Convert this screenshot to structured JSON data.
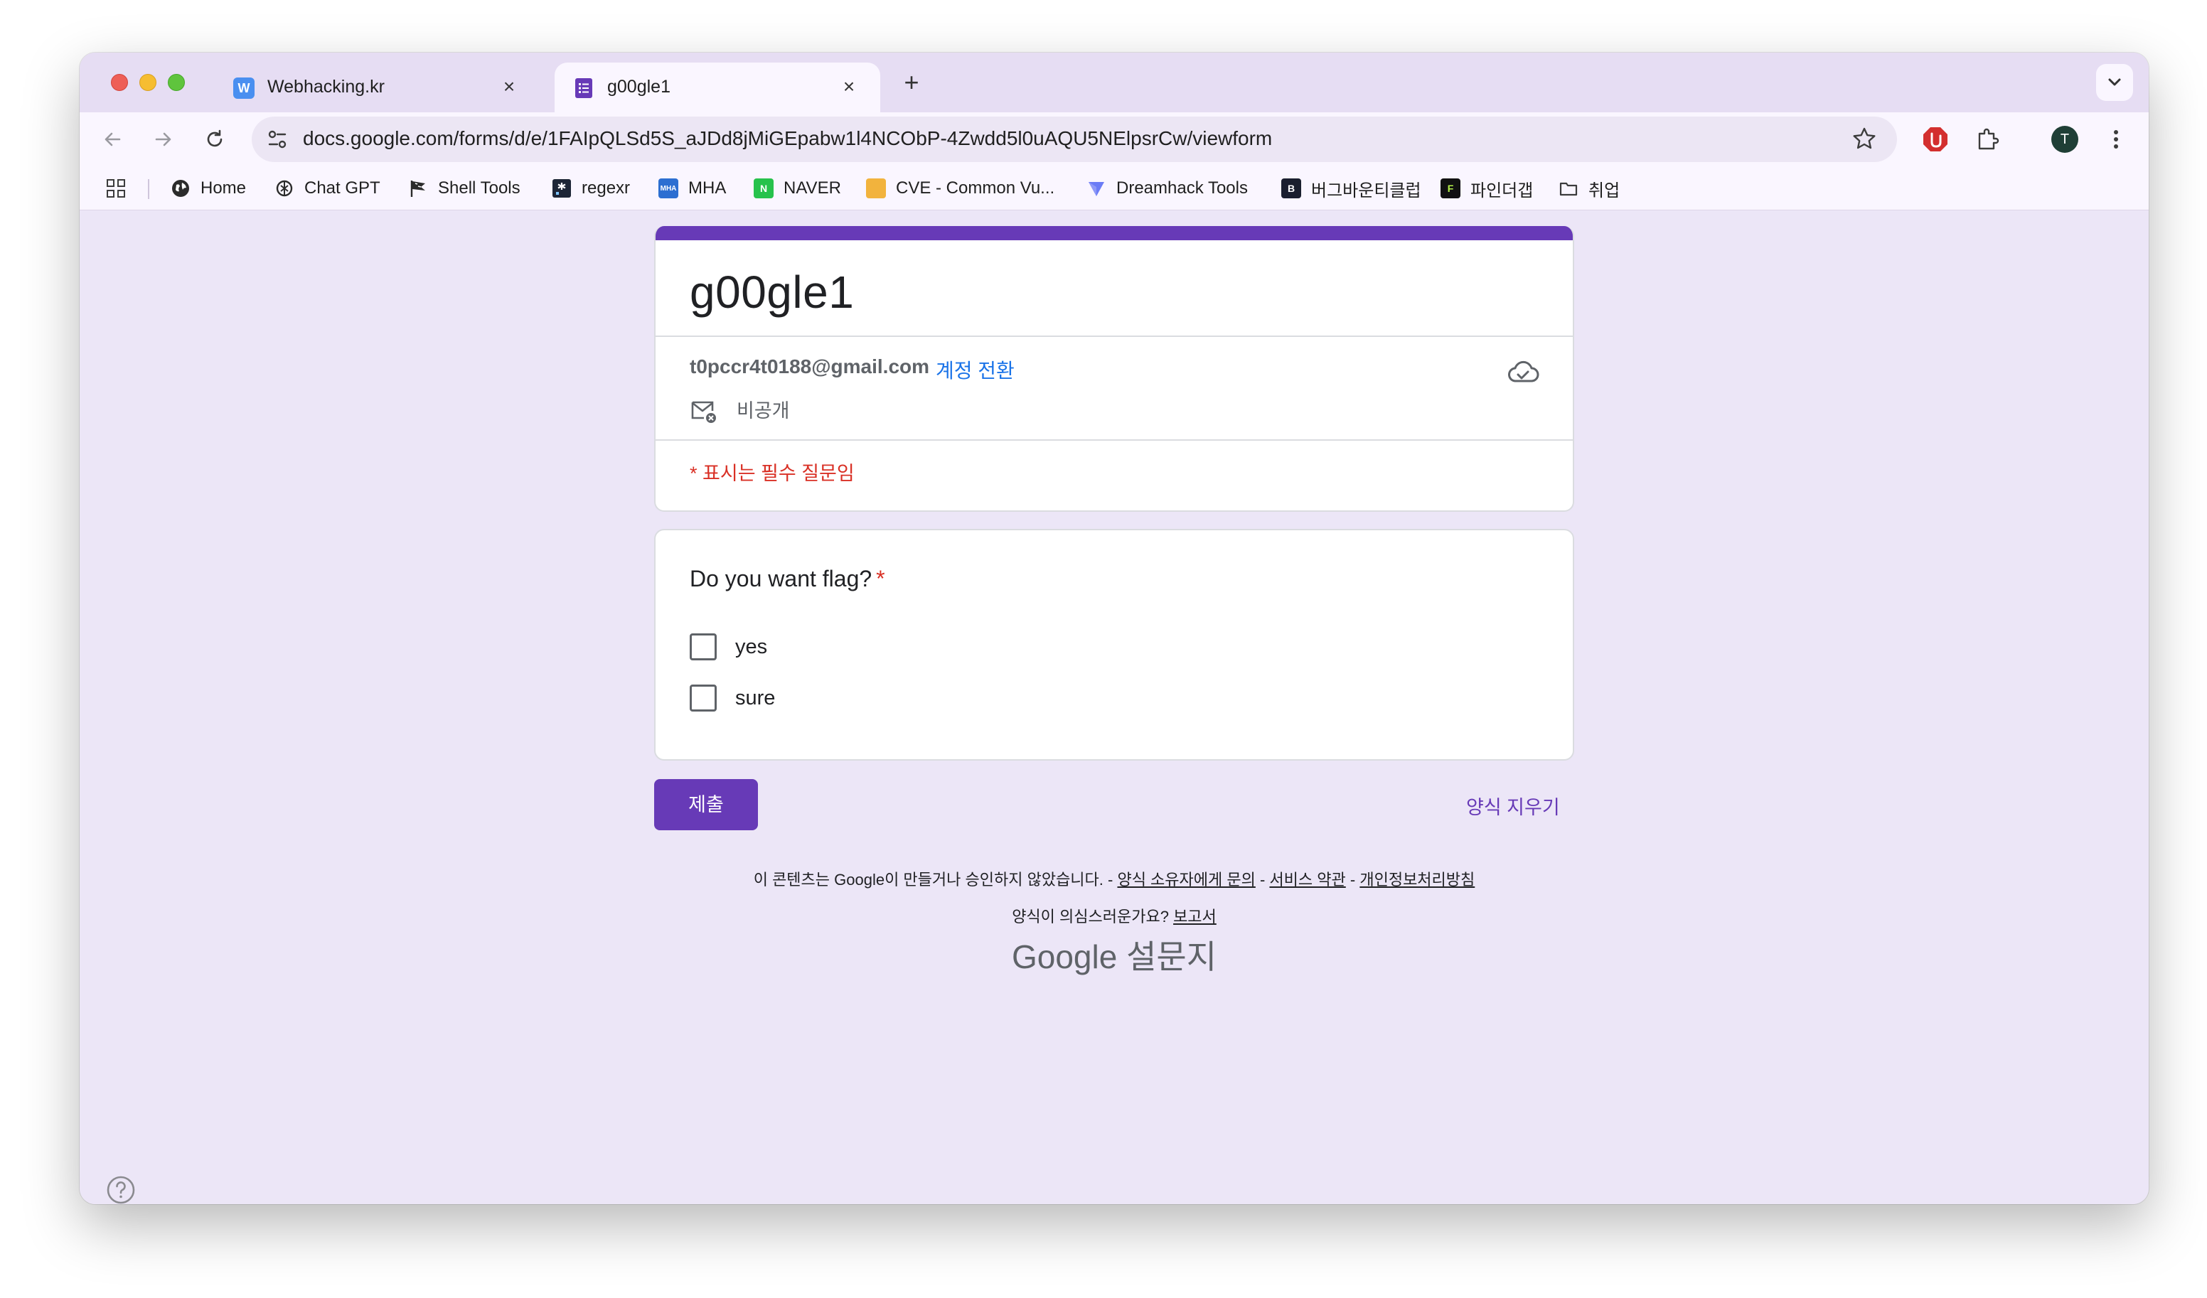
{
  "browser": {
    "tabs": [
      {
        "title": "Webhacking.kr",
        "favicon": "W",
        "color": "#4a8ff0",
        "active": false
      },
      {
        "title": "g00gle1",
        "favicon": "forms",
        "color": "#673ab7",
        "active": true
      }
    ],
    "close_glyph": "×",
    "new_tab_glyph": "+",
    "url": "docs.google.com/forms/d/e/1FAIpQLSd5S_aJDd8jMiGEpabw1l4NCObP-4Zwdd5l0uAQU5NElpsrCw/viewform",
    "avatar_initial": "T"
  },
  "bookmarks": [
    {
      "label": "Home",
      "icon": "globe-icon"
    },
    {
      "label": "Chat GPT",
      "icon": "openai-icon"
    },
    {
      "label": "Shell Tools",
      "icon": "flag-icon"
    },
    {
      "label": "regexr",
      "icon": "regexr-icon"
    },
    {
      "label": "MHA",
      "icon": "mha-icon",
      "text": "MHA"
    },
    {
      "label": "NAVER",
      "icon": "naver-icon",
      "text": "N"
    },
    {
      "label": "CVE - Common Vu...",
      "icon": "cve-icon"
    },
    {
      "label": "Dreamhack Tools",
      "icon": "dreamhack-icon"
    },
    {
      "label": "버그바운티클럽",
      "icon": "bugbounty-icon",
      "text": "B"
    },
    {
      "label": "파인더갭",
      "icon": "findergap-icon",
      "text": "F"
    },
    {
      "label": "취업",
      "icon": "folder-icon"
    }
  ],
  "form": {
    "title": "g00gle1",
    "account_email": "t0pccr4t0188@gmail.com",
    "switch_account": "계정 전환",
    "privacy_label": "비공개",
    "required_note": "* 표시는 필수 질문임",
    "question": {
      "title": "Do you want flag?",
      "required_mark": "*",
      "options": [
        "yes",
        "sure"
      ]
    },
    "submit_label": "제출",
    "clear_label": "양식 지우기"
  },
  "footer": {
    "disclaimer": "이 콘텐츠는 Google이 만들거나 승인하지 않았습니다. -",
    "contact_owner": "양식 소유자에게 문의",
    "sep": "-",
    "terms": "서비스 약관",
    "privacy_policy": "개인정보처리방침",
    "suspicious": "양식이 의심스러운가요?",
    "report": "보고서",
    "brand_google": "Google",
    "brand_forms": "설문지"
  },
  "colors": {
    "accent": "#673ab7",
    "required": "#d93025",
    "link": "#1a73e8"
  }
}
